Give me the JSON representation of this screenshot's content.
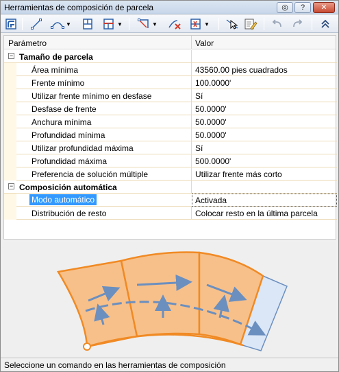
{
  "window": {
    "title": "Herramientas de composición de parcela"
  },
  "grid": {
    "headers": {
      "param": "Parámetro",
      "value": "Valor"
    },
    "categories": [
      {
        "label": "Tamaño de parcela",
        "rows": [
          {
            "label": "Área mínima",
            "value": "43560.00 pies cuadrados"
          },
          {
            "label": "Frente mínimo",
            "value": "100.0000'"
          },
          {
            "label": "Utilizar frente mínimo en desfase",
            "value": "Sí"
          },
          {
            "label": "Desfase de frente",
            "value": "50.0000'"
          },
          {
            "label": "Anchura mínima",
            "value": "50.0000'"
          },
          {
            "label": "Profundidad mínima",
            "value": "50.0000'"
          },
          {
            "label": "Utilizar profundidad máxima",
            "value": "Sí"
          },
          {
            "label": "Profundidad máxima",
            "value": "500.0000'"
          },
          {
            "label": "Preferencia de solución múltiple",
            "value": "Utilizar frente más corto"
          }
        ]
      },
      {
        "label": "Composición automática",
        "rows": [
          {
            "label": "Modo automático",
            "value": "Activada"
          },
          {
            "label": "Distribución de resto",
            "value": "Colocar resto en la última parcela"
          }
        ]
      }
    ]
  },
  "status": {
    "text": "Seleccione un comando en las herramientas de composición"
  },
  "colors": {
    "parcel_fill": "#f7c08a",
    "parcel_edge": "#f08a24",
    "arrow": "#6b8fbf",
    "remainder_fill": "#dbe7f7"
  }
}
